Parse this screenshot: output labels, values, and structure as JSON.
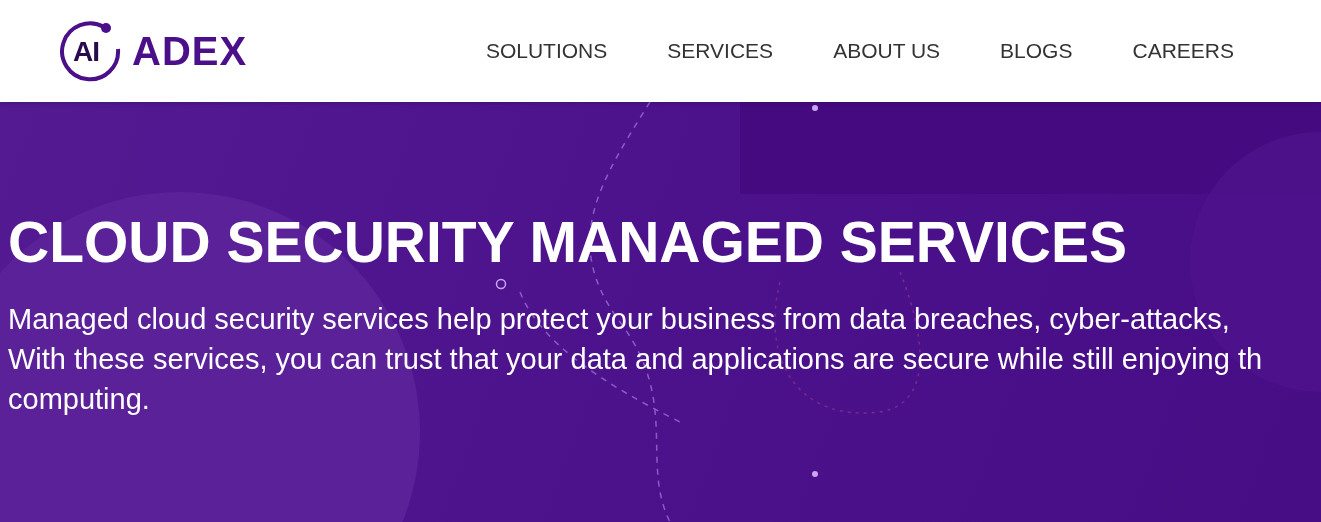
{
  "header": {
    "logo": {
      "mark": "AI",
      "name": "ADEX"
    },
    "nav": [
      {
        "label": "SOLUTIONS"
      },
      {
        "label": "SERVICES"
      },
      {
        "label": "ABOUT US"
      },
      {
        "label": "BLOGS"
      },
      {
        "label": "CAREERS"
      }
    ]
  },
  "hero": {
    "title": "CLOUD SECURITY MANAGED SERVICES",
    "lines": [
      "Managed cloud security services help protect your business from data breaches, cyber-attacks,",
      "With these services, you can trust that your data and applications are secure while still enjoying th",
      "computing."
    ]
  }
}
